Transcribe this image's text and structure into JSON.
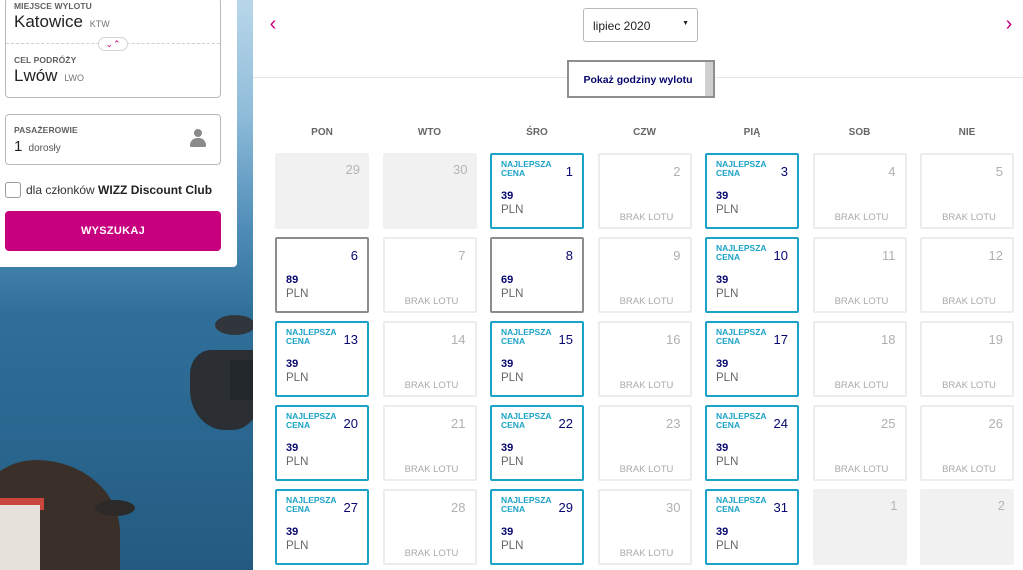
{
  "search_form": {
    "departure_label": "MIEJSCE WYLOTU",
    "departure_city": "Katowice",
    "departure_code": "KTW",
    "swap_icon": "chevron-up-down-icon",
    "destination_label": "CEL PODRÓŻY",
    "destination_city": "Lwów",
    "destination_code": "LWO",
    "passengers_label": "PASAŻEROWIE",
    "passengers_count": "1",
    "passengers_unit": "dorosły",
    "passengers_icon": "person-icon",
    "club_text_prefix": "dla członków",
    "club_text_bold": "WIZZ Discount Club",
    "club_checked": false,
    "search_button": "WYSZUKAJ",
    "accent_color": "#c6007e"
  },
  "calendar": {
    "month": "lipiec 2020",
    "toggle_label": "Pokaż godziny wylotu",
    "prev_icon": "chevron-left-icon",
    "next_icon": "chevron-right-icon",
    "weekdays": [
      "PON",
      "WTO",
      "ŚRO",
      "CZW",
      "PIĄ",
      "SOB",
      "NIE"
    ],
    "best_label": "NAJLEPSZA CENA",
    "no_flight_label": "BRAK LOTU",
    "currency": "PLN",
    "days": [
      {
        "day": "29",
        "status": "other"
      },
      {
        "day": "30",
        "status": "other"
      },
      {
        "day": "1",
        "status": "best",
        "price": "39"
      },
      {
        "day": "2",
        "status": "none"
      },
      {
        "day": "3",
        "status": "best",
        "price": "39"
      },
      {
        "day": "4",
        "status": "none"
      },
      {
        "day": "5",
        "status": "none"
      },
      {
        "day": "6",
        "status": "available",
        "price": "89"
      },
      {
        "day": "7",
        "status": "none"
      },
      {
        "day": "8",
        "status": "available",
        "price": "69"
      },
      {
        "day": "9",
        "status": "none"
      },
      {
        "day": "10",
        "status": "best",
        "price": "39"
      },
      {
        "day": "11",
        "status": "none"
      },
      {
        "day": "12",
        "status": "none"
      },
      {
        "day": "13",
        "status": "best",
        "price": "39"
      },
      {
        "day": "14",
        "status": "none"
      },
      {
        "day": "15",
        "status": "best",
        "price": "39"
      },
      {
        "day": "16",
        "status": "none"
      },
      {
        "day": "17",
        "status": "best",
        "price": "39"
      },
      {
        "day": "18",
        "status": "none"
      },
      {
        "day": "19",
        "status": "none"
      },
      {
        "day": "20",
        "status": "best",
        "price": "39"
      },
      {
        "day": "21",
        "status": "none"
      },
      {
        "day": "22",
        "status": "best",
        "price": "39"
      },
      {
        "day": "23",
        "status": "none"
      },
      {
        "day": "24",
        "status": "best",
        "price": "39"
      },
      {
        "day": "25",
        "status": "none"
      },
      {
        "day": "26",
        "status": "none"
      },
      {
        "day": "27",
        "status": "best",
        "price": "39"
      },
      {
        "day": "28",
        "status": "none"
      },
      {
        "day": "29",
        "status": "best",
        "price": "39"
      },
      {
        "day": "30",
        "status": "none"
      },
      {
        "day": "31",
        "status": "best",
        "price": "39"
      },
      {
        "day": "1",
        "status": "other"
      },
      {
        "day": "2",
        "status": "other"
      }
    ]
  }
}
